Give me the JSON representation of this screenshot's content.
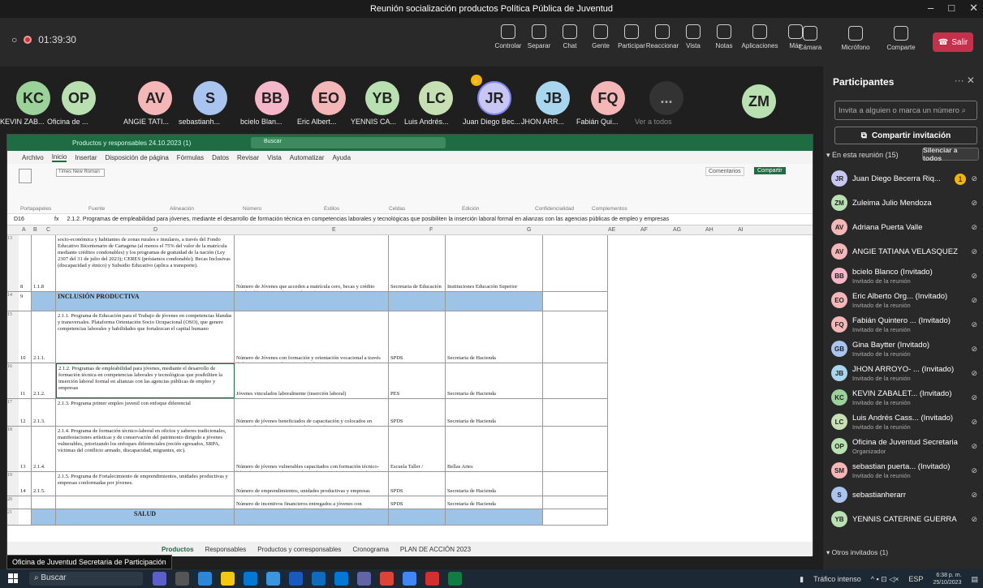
{
  "window": {
    "title": "Reunión socialización productos Política Pública de Juventud"
  },
  "toolbar": {
    "timer": "01:39:30",
    "items": [
      {
        "label": "Controlar"
      },
      {
        "label": "Separar"
      },
      {
        "label": "Chat"
      },
      {
        "label": "Gente"
      },
      {
        "label": "Participar"
      },
      {
        "label": "Reaccionar"
      },
      {
        "label": "Vista"
      },
      {
        "label": "Notas"
      },
      {
        "label": "Aplicaciones"
      },
      {
        "label": "Más"
      }
    ],
    "camera": "Cámara",
    "mic": "Micrófono",
    "share": "Comparte",
    "leave": "Salir"
  },
  "gallery": [
    {
      "initials": "KC",
      "name": "KEVIN ZAB...",
      "color": "#9ad29a"
    },
    {
      "initials": "OP",
      "name": "Oficina de ...",
      "color": "#b8e0b0"
    },
    {
      "initials": "AV",
      "name": "ANGIE TATI...",
      "color": "#f4b6b6"
    },
    {
      "initials": "S",
      "name": "sebastianh...",
      "color": "#a9c4ef"
    },
    {
      "initials": "BB",
      "name": "bcielo Blan...",
      "color": "#f4b6c8"
    },
    {
      "initials": "EO",
      "name": "Eric Albert...",
      "color": "#f4b6b6"
    },
    {
      "initials": "YB",
      "name": "YENNIS CA...",
      "color": "#b8e0b0"
    },
    {
      "initials": "LC",
      "name": "Luis Andrés...",
      "color": "#c6e0b4"
    },
    {
      "initials": "JR",
      "name": "Juan Diego Bec...",
      "color": "#c8c6f2"
    },
    {
      "initials": "JB",
      "name": "JHON ARR...",
      "color": "#a9d6ef"
    },
    {
      "initials": "FQ",
      "name": "Fabián Qui...",
      "color": "#f4b6b6"
    },
    {
      "initials": "...",
      "name": "Ver a todos",
      "color": "#444"
    },
    {
      "initials": "ZM",
      "name": "",
      "color": "#b8e0b0"
    }
  ],
  "excel": {
    "title": "Productos y responsables 24.10.2023 (1)",
    "search": "Buscar",
    "menu": [
      "Archivo",
      "Inicio",
      "Insertar",
      "Disposición de página",
      "Fórmulas",
      "Datos",
      "Revisar",
      "Vista",
      "Automatizar",
      "Ayuda"
    ],
    "groups": [
      "Portapapeles",
      "Fuente",
      "Alineación",
      "Número",
      "Estilos",
      "Celdas",
      "Edición",
      "Confidencialidad",
      "Complementos"
    ],
    "comments": "Comentarios",
    "share": "Compartir",
    "cellref": "D16",
    "formula": "2.1.2. Programas de empleabilidad para jóvenes, mediante el desarrollo de formación técnica en competencias laborales y tecnológicas que posibiliten la inserción laboral formal en alianzas con las agencias públicas de empleo y empresas",
    "cols": [
      "A",
      "B",
      "C",
      "D",
      "E",
      "F",
      "G",
      "AE",
      "AF",
      "AG",
      "AH",
      "AI"
    ],
    "rows": [
      {
        "n": "13",
        "b": "8",
        "c": "1.1.8",
        "d": "socio-económica y habitantes de zonas rurales e insulares, a través del Fondo Educativo Bicentenario de Cartagena (al menos el 75% del valor de la matrícula mediante créditos condonables) y los programas de gratuidad de la nación (Ley 2307 del 31 de julio del 2023); CERES (préstamos condonable); Becas Inclusivas (discapacidad y étnico) y Subsidio Educativo (aplica a transporte).",
        "e": "Número de Jóvenes que acceden a matrícula cero, becas y crédito condonable para estudios en educación superior.",
        "f": "Secretaria de Educación",
        "g": "Instituciones Educación Superior"
      },
      {
        "n": "14",
        "b": "9",
        "c": "",
        "d": "INCLUSIÓN PRODUCTIVA",
        "e": "",
        "f": "",
        "g": ""
      },
      {
        "n": "15",
        "b": "10",
        "c": "2.1.1.",
        "d": "2.1.1. Programa de Educación para el Trabajo de jóvenes en competencias blandas y transversales. Plataforma Orientación Socio Ocupacional (OSO), que genere competencias laborales y habilidades que fortalezcan el capital humano",
        "e": "Número de Jóvenes con formación y orientación vocacional a través de las instituciones educativas oficiales",
        "f": "SPDS",
        "g": "Secretaria de Hacienda"
      },
      {
        "n": "16",
        "b": "11",
        "c": "2.1.2.",
        "d": "2.1.2. Programas de empleabilidad para jóvenes, mediante el desarrollo de formación técnica en competencias laborales y tecnológicas que posibiliten la inserción laboral formal en alianzas con las agencias públicas de empleo y empresas",
        "e": "Jóvenes vinculados laboralmente (inserción laboral)",
        "f": "PES",
        "g": "Secretaria de Hacienda"
      },
      {
        "n": "17",
        "b": "12",
        "c": "2.1.3.",
        "d": "2.1.3. Programa primer empleo juvenil con enfoque diferencial",
        "e": "Número de jóvenes beneficiados de capacitación y colocados en puestos de trabajo con enfoque diferencial.",
        "f": "SPDS",
        "g": "Secretaria de Hacienda"
      },
      {
        "n": "18",
        "b": "13",
        "c": "2.1.4.",
        "d": "2.1.4. Programa de formación técnico-laboral en oficios y saberes tradicionales, manifestaciones artísticas y de conservación del patrimonio dirigido a jóvenes vulnerables, priorizando los enfoques diferenciales (recién egresados, SRPA, víctimas del conflicto armado, discapacidad, migrantes, etc).",
        "e": "Número de jóvenes vulnerables capacitados con formación técnico-laboral en oficios y saberes tradicionales, manifestaciones artísticas y conservación del patrimonio con enfoque diferencial.",
        "f": "Escuela Taller /",
        "g": "Bellas Artes"
      },
      {
        "n": "19",
        "b": "14",
        "c": "2.1.5.",
        "d": "2.1.5. Programa de Fortalecimiento de emprendimientos, unidades productivas y empresas conformadas por jóvenes.",
        "e": "Número de emprendimientos, unidades productivas y empresas conformadas y con participación de jóvenes.",
        "f": "SPDS",
        "g": "Secretaria de Hacienda"
      },
      {
        "n": "20",
        "b": "",
        "c": "",
        "d": "",
        "e": "Número de incentivos financieros entregados a jóvenes con emprendimientos, unidades productivas y empresas conformadas.",
        "f": "SPDS",
        "g": "Secretaria de Hacienda"
      },
      {
        "n": "21",
        "b": "",
        "c": "",
        "d": "SALUD",
        "e": "",
        "f": "",
        "g": ""
      }
    ],
    "tabs": [
      "Productos",
      "Responsables",
      "Productos y corresponsables",
      "Cronograma",
      "PLAN DE ACCIÓN 2023"
    ]
  },
  "presenter_tooltip": "Oficina de Juventud Secretaria de Participación",
  "panel": {
    "title": "Participantes",
    "invite_placeholder": "Invita a alguien o marca un número",
    "share_invite": "Compartir invitación",
    "in_meeting": "En esta reunión (15)",
    "mute_all": "Silenciar a todos",
    "list": [
      {
        "i": "JR",
        "name": "Juan Diego Becerra Riq...",
        "sub": "",
        "color": "#c8c6f2",
        "hand": "1"
      },
      {
        "i": "ZM",
        "name": "Zuleima Julio Mendoza",
        "sub": "",
        "color": "#b8e0b0"
      },
      {
        "i": "AV",
        "name": "Adriana Puerta Valle",
        "sub": "",
        "color": "#f4b6b6"
      },
      {
        "i": "AV",
        "name": "ANGIE TATIANA VELASQUEZ",
        "sub": "",
        "color": "#f4b6b6"
      },
      {
        "i": "BB",
        "name": "bcielo Blanco (Invitado)",
        "sub": "Invitado de la reunión",
        "color": "#f4b6c8"
      },
      {
        "i": "EO",
        "name": "Eric Alberto Org... (Invitado)",
        "sub": "Invitado de la reunión",
        "color": "#f4b6b6"
      },
      {
        "i": "FQ",
        "name": "Fabián Quintero ... (Invitado)",
        "sub": "Invitado de la reunión",
        "color": "#f4b6b6"
      },
      {
        "i": "GB",
        "name": "Gina Baytter (Invitado)",
        "sub": "Invitado de la reunión",
        "color": "#a9c4ef"
      },
      {
        "i": "JB",
        "name": "JHON ARROYO- ... (Invitado)",
        "sub": "Invitado de la reunión",
        "color": "#a9d6ef"
      },
      {
        "i": "KC",
        "name": "KEVIN ZABALET... (Invitado)",
        "sub": "Invitado de la reunión",
        "color": "#9ad29a"
      },
      {
        "i": "LC",
        "name": "Luis Andrés Cass... (Invitado)",
        "sub": "Invitado de la reunión",
        "color": "#c6e0b4"
      },
      {
        "i": "OP",
        "name": "Oficina de Juventud Secretaria d...",
        "sub": "Organizador",
        "color": "#b8e0b0"
      },
      {
        "i": "SM",
        "name": "sebastian puerta... (Invitado)",
        "sub": "Invitado de la reunión",
        "color": "#f4b6b6"
      },
      {
        "i": "S",
        "name": "sebastianherarr",
        "sub": "",
        "color": "#a9c4ef"
      },
      {
        "i": "YB",
        "name": "YENNIS CATERINE GUERRA BOLI...",
        "sub": "",
        "color": "#b8e0b0"
      }
    ],
    "others": "Otros invitados (1)"
  },
  "taskbar": {
    "search": "Buscar",
    "traffic": "Tráfico intenso",
    "lang": "ESP",
    "time": "6:38 p. m.",
    "date": "25/10/2023"
  }
}
